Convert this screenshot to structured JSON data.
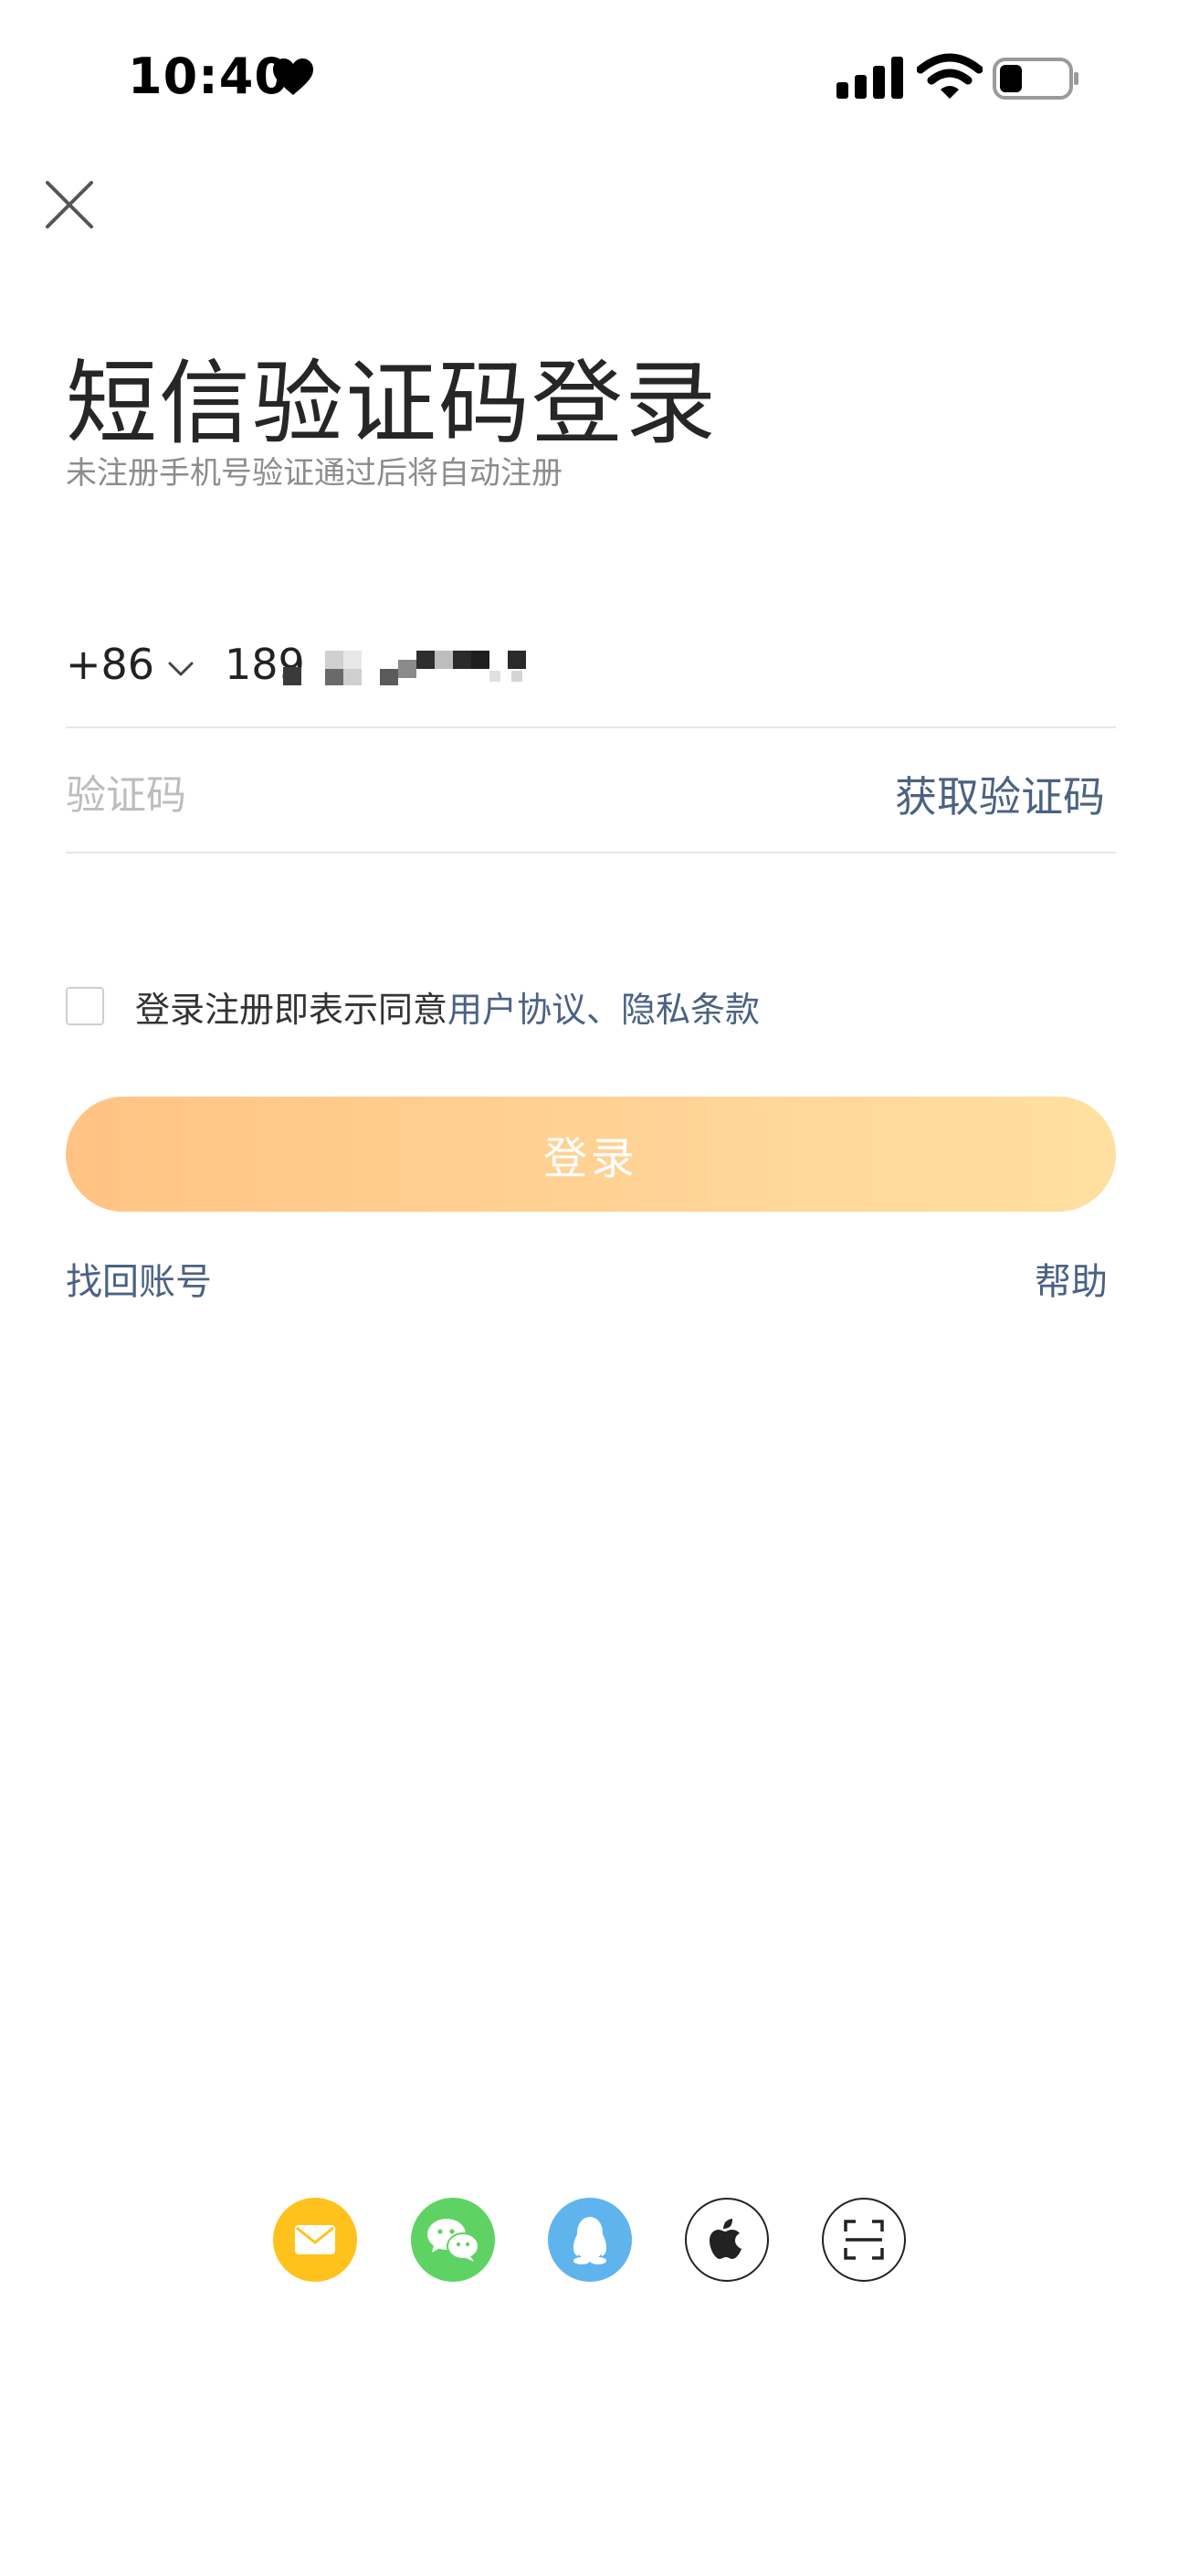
{
  "status_bar": {
    "time": "10:40",
    "icons": [
      "heart-icon",
      "signal-icon",
      "wifi-icon",
      "battery-icon"
    ]
  },
  "header": {
    "close_icon": "close-icon",
    "title": "短信验证码登录",
    "subtitle": "未注册手机号验证通过后将自动注册"
  },
  "form": {
    "country_code": "+86",
    "phone_visible": "189",
    "code_placeholder": "验证码",
    "get_code_label": "获取验证码"
  },
  "agreement": {
    "prefix": "登录注册即表示同意",
    "user_agreement": "用户协议",
    "separator": "、",
    "privacy": "隐私条款",
    "checked": false
  },
  "login_label": "登录",
  "links": {
    "find_account": "找回账号",
    "help": "帮助"
  },
  "third_party": [
    {
      "icon": "mail-icon",
      "color": "#ffc21c"
    },
    {
      "icon": "wechat-icon",
      "color": "#5ed363"
    },
    {
      "icon": "qq-icon",
      "color": "#5fb4ee"
    },
    {
      "icon": "apple-icon",
      "color": "#222222"
    },
    {
      "icon": "scan-icon",
      "color": "#222222"
    }
  ],
  "colors": {
    "link": "#4b6283",
    "button_gradient_start": "#ffc07d",
    "button_gradient_end": "#ffde9c"
  }
}
